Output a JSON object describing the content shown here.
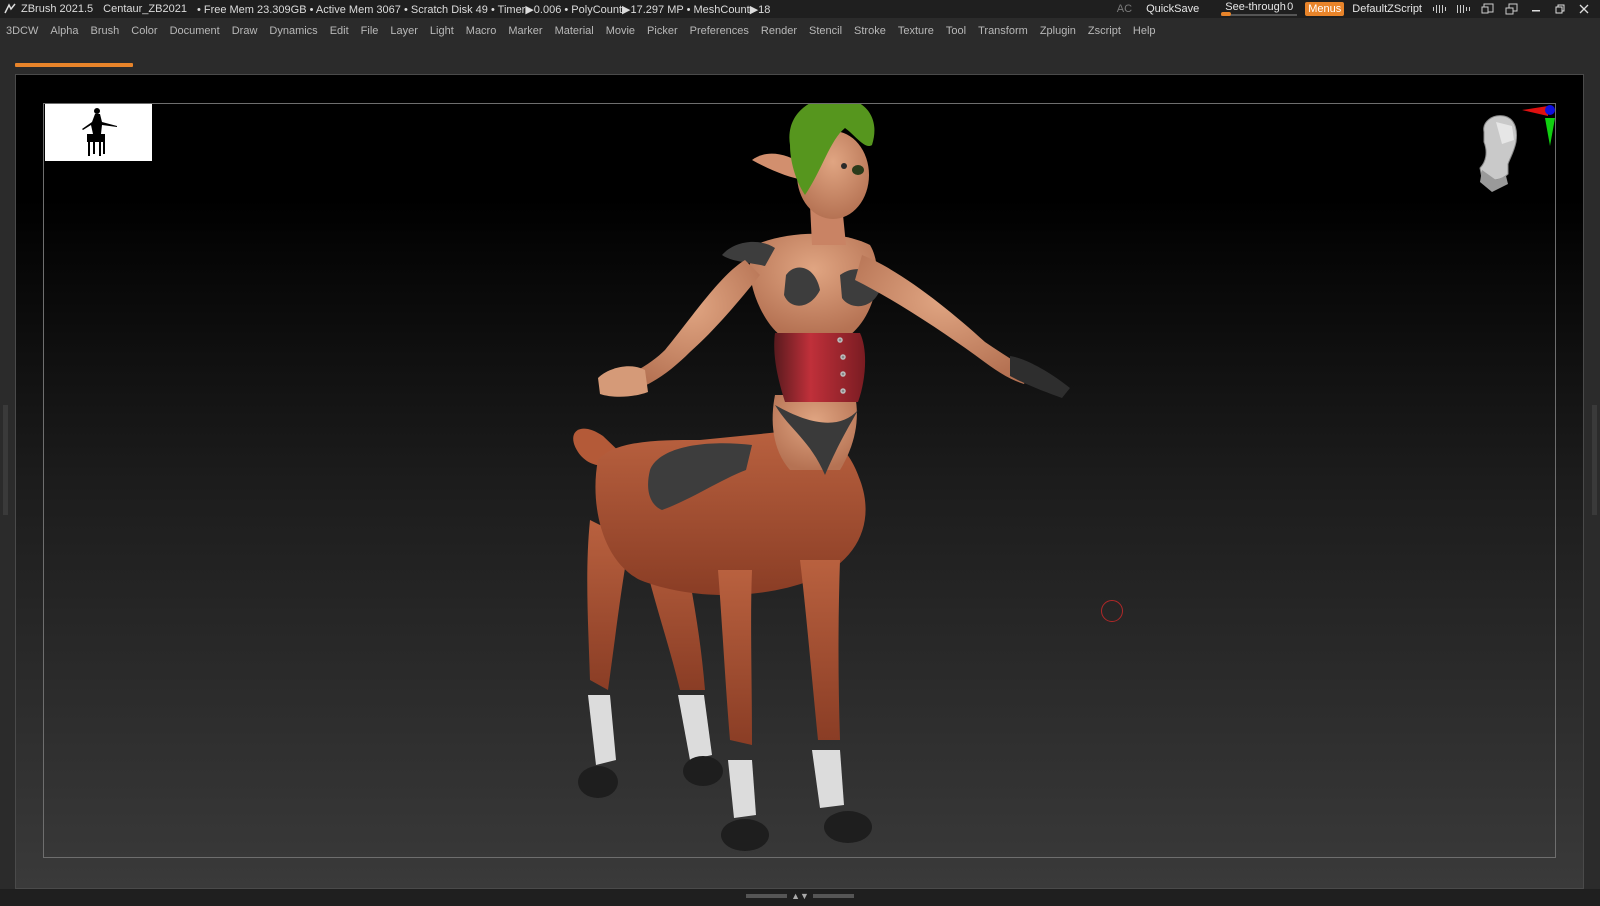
{
  "app": {
    "name": "ZBrush 2021.5",
    "document": "Centaur_ZB2021",
    "stats": "• Free Mem 23.309GB • Active Mem 3067 • Scratch Disk 49 •  Timer▶0.006 • PolyCount▶17.297 MP  • MeshCount▶18"
  },
  "toolbar": {
    "ac_label": "AC",
    "quicksave_label": "QuickSave",
    "seethrough_label": "See-through",
    "seethrough_value": "0",
    "menus_label": "Menus",
    "script_label": "DefaultZScript"
  },
  "menu": {
    "items": [
      "3DCW",
      "Alpha",
      "Brush",
      "Color",
      "Document",
      "Draw",
      "Dynamics",
      "Edit",
      "File",
      "Layer",
      "Light",
      "Macro",
      "Marker",
      "Material",
      "Movie",
      "Picker",
      "Preferences",
      "Render",
      "Stencil",
      "Stroke",
      "Texture",
      "Tool",
      "Transform",
      "Zplugin",
      "Zscript",
      "Help"
    ]
  },
  "colors": {
    "accent": "#e8842a",
    "background": "#2b2b2b",
    "skin": "#c98a66",
    "horse_body": "#a34f33",
    "hair": "#56961e",
    "corset": "#b0262e"
  },
  "icons": {
    "app": "zbrush-logo-icon",
    "navigation": "head-gizmo-icon",
    "cursor": "brush-circle-icon"
  }
}
